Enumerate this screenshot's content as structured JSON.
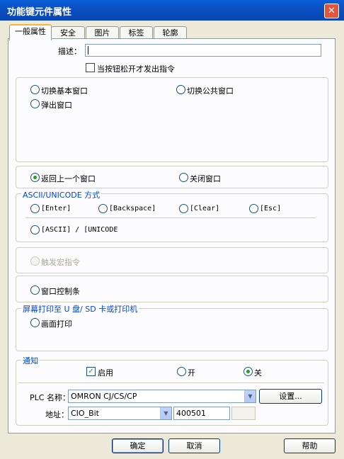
{
  "window": {
    "title": "功能键元件属性",
    "close_glyph": "✕"
  },
  "tabs": [
    {
      "label": "一般属性",
      "active": true
    },
    {
      "label": "安全",
      "active": false
    },
    {
      "label": "图片",
      "active": false
    },
    {
      "label": "标签",
      "active": false
    },
    {
      "label": "轮廓",
      "active": false
    }
  ],
  "description": {
    "label": "描述：",
    "value": ""
  },
  "release_checkbox": {
    "label": "当按钮松开才发出指令",
    "checked": false
  },
  "window_group": {
    "switch_base": "切换基本窗口",
    "switch_common": "切换公共窗口",
    "popup": "弹出窗口"
  },
  "return_group": {
    "return_prev": "返回上一个窗口",
    "close_window": "关闭窗口",
    "selected": "return_prev"
  },
  "ascii_group": {
    "legend": "ASCII/UNICODE 方式",
    "enter": "[Enter]",
    "backspace": "[Backspace]",
    "clear": "[Clear]",
    "esc": "[Esc]",
    "ascii_unicode": "[ASCII] / [UNICODE"
  },
  "macro": {
    "label": "触发宏指令",
    "enabled": false
  },
  "window_bar": {
    "label": "窗口控制条"
  },
  "print_group": {
    "legend": "屏幕打印至 U 盘/ SD 卡或打印机",
    "screen_print": "画面打印"
  },
  "notify_group": {
    "legend": "通知",
    "enable": {
      "label": "启用",
      "checked": true
    },
    "on": "开",
    "off": "关",
    "selected": "off",
    "plc_label": "PLC 名称：",
    "plc_value": "OMRON CJ/CS/CP",
    "settings_button": "设置...",
    "address_label": "地址：",
    "address_type": "CIO_Bit",
    "address_value": "400501"
  },
  "footer": {
    "ok": "确定",
    "cancel": "取消",
    "help": "帮助"
  },
  "colors": {
    "titlebar": "#0a5fd8",
    "legend": "#0046d5",
    "dialog_bg": "#ece9d8",
    "radio_dot": "#21a121"
  }
}
